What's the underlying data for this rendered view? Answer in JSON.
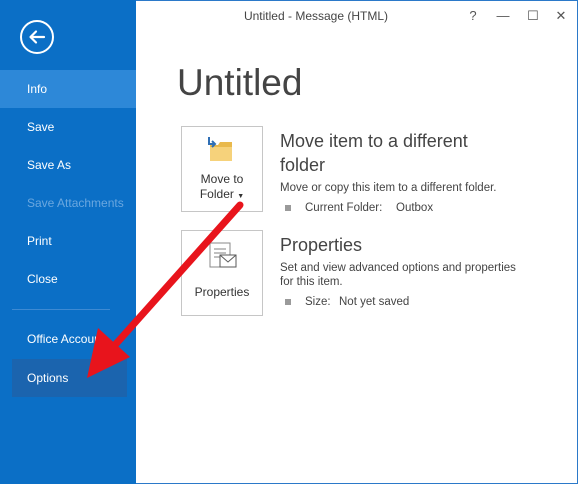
{
  "window": {
    "title": "Untitled - Message (HTML)",
    "help": "?",
    "minimize": "—",
    "maximize": "☐",
    "close": "✕"
  },
  "sidebar": {
    "items": [
      {
        "label": "Info",
        "selected": true
      },
      {
        "label": "Save"
      },
      {
        "label": "Save As"
      },
      {
        "label": "Save Attachments",
        "disabled": true
      },
      {
        "label": "Print"
      },
      {
        "label": "Close"
      },
      {
        "label": "Office Account"
      },
      {
        "label": "Options"
      }
    ]
  },
  "main": {
    "heading": "Untitled",
    "move": {
      "button_line1": "Move to",
      "button_line2": "Folder",
      "title_line1": "Move item to a different",
      "title_line2": "folder",
      "description": "Move or copy this item to a different folder.",
      "detail_label": "Current Folder:",
      "detail_value": "Outbox"
    },
    "properties": {
      "button_label": "Properties",
      "title": "Properties",
      "description_line1": "Set and view advanced options and properties",
      "description_line2": "for this item.",
      "detail_label": "Size:",
      "detail_value": "Not yet saved"
    }
  },
  "colors": {
    "sidebar": "#0b6fc6",
    "selected": "#2d88d8",
    "arrow": "#e8141c"
  }
}
